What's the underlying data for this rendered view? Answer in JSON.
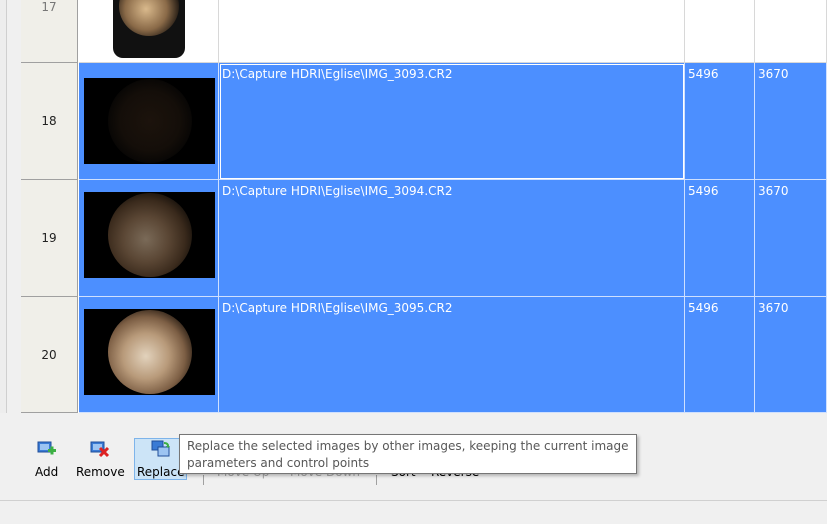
{
  "rows": [
    {
      "num": "17",
      "path": "",
      "width": "",
      "height": "",
      "selected": false
    },
    {
      "num": "18",
      "path": "D:\\Capture HDRI\\Eglise\\IMG_3093.CR2",
      "width": "5496",
      "height": "3670",
      "selected": true
    },
    {
      "num": "19",
      "path": "D:\\Capture HDRI\\Eglise\\IMG_3094.CR2",
      "width": "5496",
      "height": "3670",
      "selected": true
    },
    {
      "num": "20",
      "path": "D:\\Capture HDRI\\Eglise\\IMG_3095.CR2",
      "width": "5496",
      "height": "3670",
      "selected": true
    }
  ],
  "toolbar": {
    "add_label": "Add",
    "remove_label": "Remove",
    "replace_label": "Replace",
    "move_up_label": "Move Up",
    "move_down_label": "Move Down",
    "sort_label": "Sort",
    "reverse_label": "Reverse"
  },
  "tooltip": {
    "text": "Replace the selected images by other images, keeping the current image parameters and control points"
  },
  "colors": {
    "selection": "#4c8fff",
    "header_bg": "#f0efe9"
  }
}
